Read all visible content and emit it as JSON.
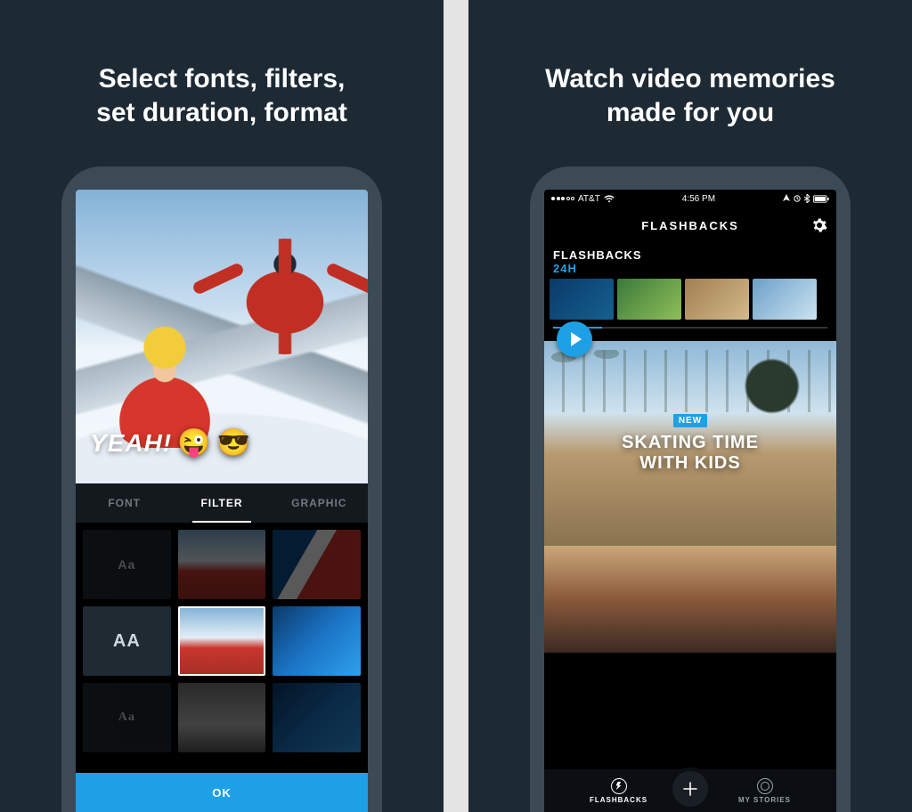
{
  "left": {
    "headline_line1": "Select fonts, filters,",
    "headline_line2": "set duration, format",
    "overlay_text": "YEAH!",
    "overlay_emoji1": "😜",
    "overlay_emoji2": "😎",
    "tabs": {
      "font": "FONT",
      "filter": "FILTER",
      "graphic": "GRAPHIC"
    },
    "font_samples": {
      "aa_upper": "AA",
      "aa_serif": "Aa",
      "aa_script": "Aa"
    },
    "ok_label": "OK"
  },
  "right": {
    "headline_line1": "Watch video memories",
    "headline_line2": "made for you",
    "status": {
      "carrier": "AT&T",
      "time": "4:56 PM"
    },
    "nav_title": "FLASHBACKS",
    "strip": {
      "title": "FLASHBACKS",
      "subtitle": "24H"
    },
    "card": {
      "badge": "NEW",
      "title_line1": "SKATING TIME",
      "title_line2": "WITH KIDS"
    },
    "bottom_nav": {
      "flashbacks": "FLASHBACKS",
      "mystories": "MY STORIES"
    }
  }
}
